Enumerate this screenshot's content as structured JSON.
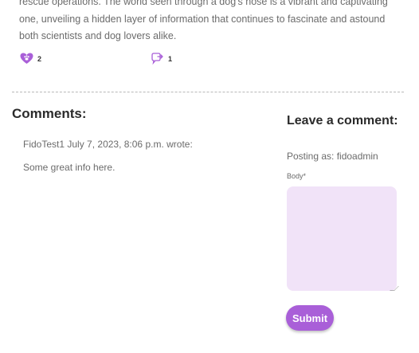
{
  "post": {
    "text": "rescue operations. The world seen through a dog's nose is a vibrant and captivating one, unveiling a hidden layer of information that continues to fascinate and astound both scientists and dog lovers alike.",
    "likes_count": "2",
    "shares_count": "1"
  },
  "comments": {
    "title": "Comments:",
    "items": [
      {
        "author": "FidoTest1",
        "date": "July 7, 2023, 8:06 p.m. wrote:",
        "body": "Some great info here."
      }
    ]
  },
  "form": {
    "title": "Leave a comment:",
    "posting_as": "Posting as: fidoadmin",
    "body_label": "Body*",
    "body_value": "",
    "submit_label": "Submit"
  },
  "colors": {
    "accent": "#a95fd8",
    "textarea_bg": "#f1e3f8"
  },
  "icons": {
    "likes": "heart-paw-icon",
    "shares": "share-bubble-icon"
  }
}
